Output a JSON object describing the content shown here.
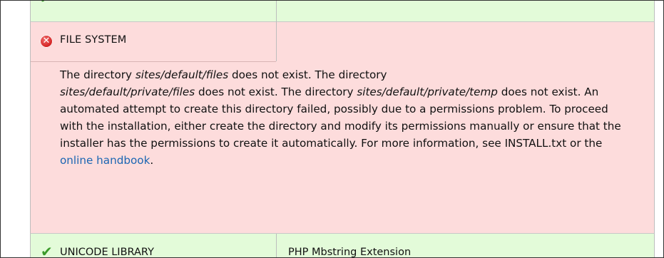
{
  "error_row": {
    "title": "FILE SYSTEM",
    "icon": "error-icon",
    "message": {
      "t1": "The directory ",
      "d1": "sites/default/files",
      "t2": " does not exist. The directory ",
      "d2": "sites/default/private/files",
      "t3": " does not exist. The directory ",
      "d3": "sites/default/private/temp",
      "t4": " does not exist. An automated attempt to create this directory failed, possibly due to a permissions problem. To proceed with the installation, either create the directory and modify its permissions manually or ensure that the installer has the permissions to create it automatically. For more information, see INSTALL.txt or the ",
      "link": "online handbook",
      "t5": "."
    }
  },
  "bottom_row": {
    "label": "UNICODE LIBRARY",
    "value": "PHP Mbstring Extension",
    "icon": "check-icon"
  },
  "top_row": {
    "icon": "check-icon"
  },
  "colors": {
    "ok_bg": "#e3fbd9",
    "error_bg": "#fddcdc",
    "link": "#1b66b3"
  }
}
